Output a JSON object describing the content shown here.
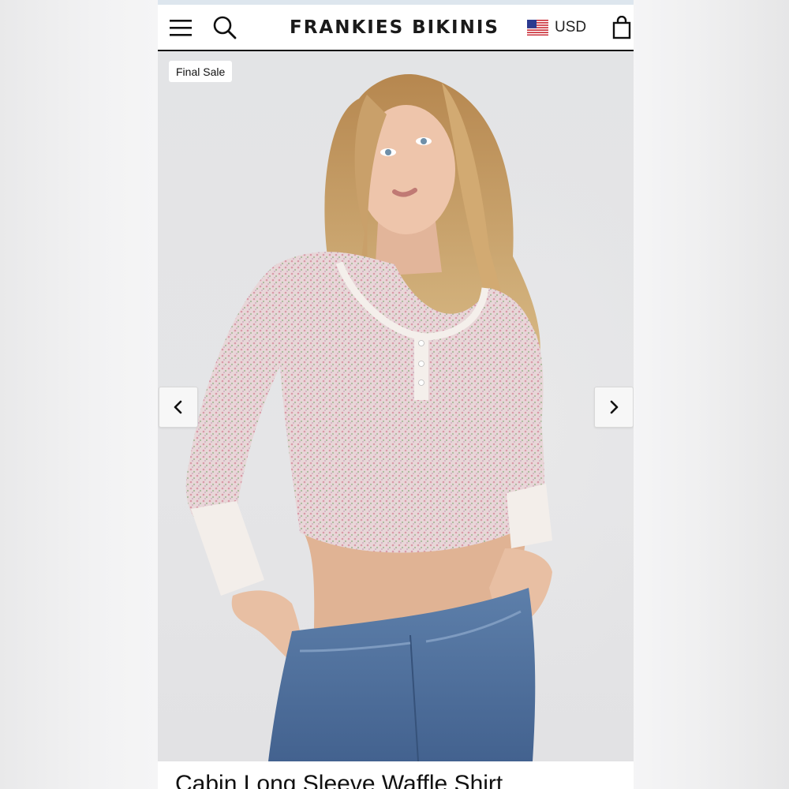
{
  "header": {
    "brand": "FRANKIES BIKINIS",
    "currency": "USD",
    "menu_icon": "hamburger-menu-icon",
    "search_icon": "search-icon",
    "flag_icon": "us-flag-icon",
    "cart_icon": "shopping-bag-icon"
  },
  "product": {
    "badge": "Final Sale",
    "title": "Cabin Long Sleeve Waffle Shirt",
    "image_alt": "Model wearing long sleeve waffle knit crop top with jeans"
  },
  "gallery": {
    "prev_icon": "chevron-left-icon",
    "next_icon": "chevron-right-icon"
  },
  "colors": {
    "accent": "#111111",
    "hero_bg": "#e4e4e6"
  }
}
